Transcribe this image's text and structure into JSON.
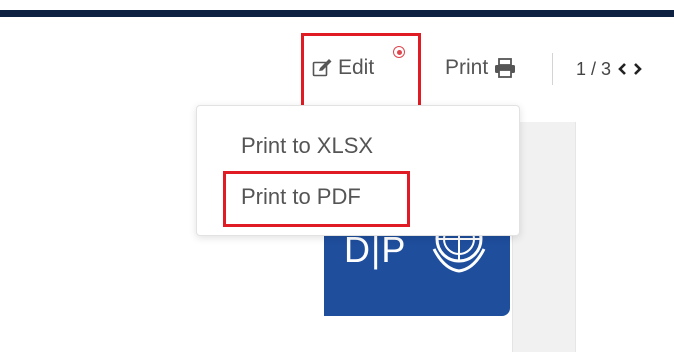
{
  "toolbar": {
    "edit_label": "Edit",
    "print_label": "Print",
    "page_indicator": "1 / 3"
  },
  "print_menu": {
    "items": [
      {
        "label": "Print to XLSX"
      },
      {
        "label": "Print to PDF"
      }
    ]
  },
  "logo": {
    "text": "D|P"
  },
  "icons": {
    "edit": "edit-icon",
    "print": "printer-icon",
    "prev": "chevron-left-icon",
    "next": "chevron-right-icon",
    "notification": "notification-dot-icon",
    "emblem": "un-emblem-icon"
  },
  "colors": {
    "header_band": "#0f2141",
    "highlight": "#e01b24",
    "notification": "#e0444d",
    "logo_bg": "#1f4e9d",
    "text": "#555555"
  }
}
